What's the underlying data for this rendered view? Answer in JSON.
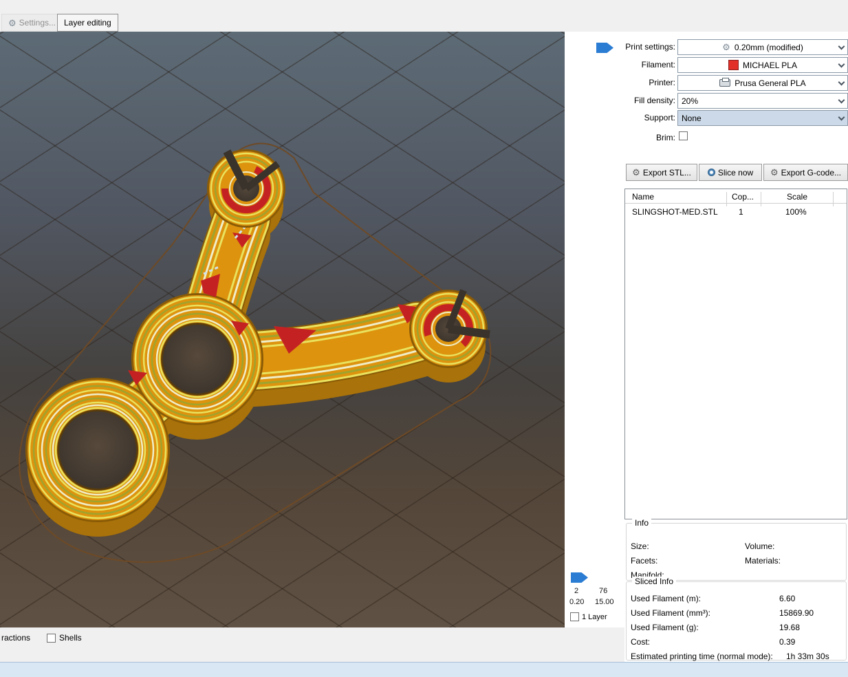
{
  "tabs": {
    "settings_label": "Settings...",
    "layer_editing_label": "Layer editing"
  },
  "settings_panel": {
    "print_settings_label": "Print settings:",
    "print_settings_value": "0.20mm (modified)",
    "filament_label": "Filament:",
    "filament_value": "MICHAEL PLA",
    "printer_label": "Printer:",
    "printer_value": "Prusa General PLA",
    "fill_density_label": "Fill density:",
    "fill_density_value": "20%",
    "support_label": "Support:",
    "support_value": "None",
    "brim_label": "Brim:"
  },
  "actions": {
    "export_stl_label": "Export STL...",
    "slice_now_label": "Slice now",
    "export_gcode_label": "Export G-code..."
  },
  "object_table": {
    "col_name": "Name",
    "col_copies": "Cop...",
    "col_scale": "Scale",
    "row": {
      "name": "SLINGSHOT-MED.STL",
      "copies": "1",
      "scale": "100%"
    }
  },
  "info_box": {
    "title": "Info",
    "size_label": "Size:",
    "volume_label": "Volume:",
    "facets_label": "Facets:",
    "materials_label": "Materials:",
    "manifold_label": "Manifold:"
  },
  "sliced_info": {
    "title": "Sliced Info",
    "rows": [
      {
        "label": "Used Filament (m):",
        "value": "6.60"
      },
      {
        "label": "Used Filament (mm³):",
        "value": "15869.90"
      },
      {
        "label": "Used Filament (g):",
        "value": "19.68"
      },
      {
        "label": "Cost:",
        "value": "0.39"
      },
      {
        "label": "Estimated printing time (normal mode):",
        "value": "1h 33m 30s"
      }
    ]
  },
  "layer_slider": {
    "min_layer": "2",
    "max_layer": "76",
    "min_z": "0.20",
    "max_z": "15.00",
    "one_layer_label": "1 Layer"
  },
  "bottom_bar": {
    "interactions_label": "ractions",
    "shells_label": "Shells"
  },
  "icons": {
    "print_settings": "gear-icon",
    "filament": "filament-color-swatch",
    "printer": "printer-icon",
    "export_stl": "gear-icon",
    "slice_now": "slice-icon",
    "export_gcode": "gear-icon",
    "settings_tab": "gear-icon"
  },
  "colors": {
    "slider_handle": "#2b7cd3",
    "filament_swatch": "#e23028",
    "model_body": "#dd930e",
    "model_infill_red": "#c42222",
    "support_combo_highlight": "#ccd9e8",
    "statusbar": "#d9e6f4"
  }
}
